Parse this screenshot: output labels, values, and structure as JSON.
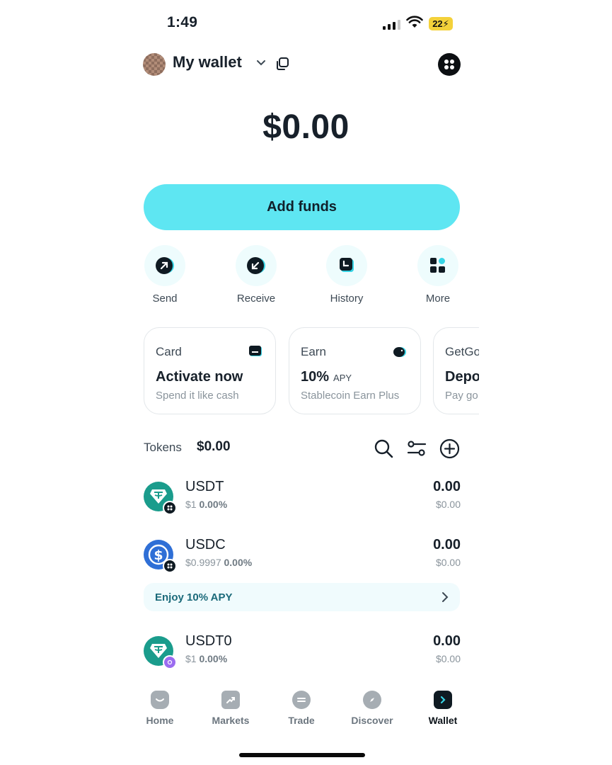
{
  "status_bar": {
    "time": "1:49",
    "battery": "22"
  },
  "header": {
    "title": "My wallet"
  },
  "balance": "$0.00",
  "add_funds_label": "Add funds",
  "actions": [
    {
      "label": "Send",
      "icon": "arrow-up-right-icon"
    },
    {
      "label": "Receive",
      "icon": "arrow-down-left-icon"
    },
    {
      "label": "History",
      "icon": "history-icon"
    },
    {
      "label": "More",
      "icon": "grid-icon"
    }
  ],
  "cards": [
    {
      "kind": "Card",
      "headline": "Activate now",
      "sub": "Spend it like cash",
      "icon": "card-icon"
    },
    {
      "kind": "Earn",
      "headline": "10%",
      "headline_suffix": "APY",
      "sub": "Stablecoin Earn Plus",
      "icon": "piggy-bank-icon"
    },
    {
      "kind": "GetGo",
      "headline": "Deposit",
      "sub": "Pay go"
    }
  ],
  "tokens": {
    "label": "Tokens",
    "total": "$0.00",
    "rows": [
      {
        "symbol": "USDT",
        "price": "$1",
        "change": "0.00%",
        "amount": "0.00",
        "value": "$0.00",
        "color": "#1a9c8c"
      },
      {
        "symbol": "USDC",
        "price": "$0.9997",
        "change": "0.00%",
        "amount": "0.00",
        "value": "$0.00",
        "color": "#2f6fd6"
      },
      {
        "symbol": "USDT0",
        "price": "$1",
        "change": "0.00%",
        "amount": "0.00",
        "value": "$0.00",
        "color": "#1a9c8c"
      }
    ]
  },
  "promo": {
    "text": "Enjoy 10% APY"
  },
  "nav": [
    {
      "label": "Home",
      "icon": "home-icon"
    },
    {
      "label": "Markets",
      "icon": "markets-icon"
    },
    {
      "label": "Trade",
      "icon": "trade-icon"
    },
    {
      "label": "Discover",
      "icon": "compass-icon"
    },
    {
      "label": "Wallet",
      "icon": "wallet-icon",
      "active": true
    }
  ],
  "colors": {
    "accent": "#5ee6f2",
    "text": "#17202a",
    "muted": "#8a949c"
  }
}
